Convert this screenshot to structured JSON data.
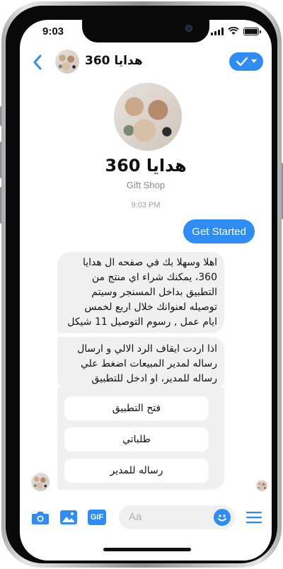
{
  "status_bar": {
    "time": "9:03"
  },
  "header": {
    "title": "هدايا 360"
  },
  "profile": {
    "name": "هدايا 360",
    "category": "Gift Shop"
  },
  "timestamp": "9:03 PM",
  "messages": {
    "sent": "Get Started",
    "bot_1_lines": [
      "اهلا وسهلا بك في صفحه ال هدايا",
      "360، يمكنك شراء اي منتج من",
      "التطبيق بداخل المسنجر وسيتم",
      "توصيله لعنوانك خلال اربع لخمس",
      "ايام عمل , رسوم التوصيل 11 شيكل"
    ],
    "bot_2_lines": [
      "اذا اردت ايقاف الرد الالي و ارسال",
      "رساله لمدير المبيعات اضغط علي",
      "رساله للمدير، او ادخل للتطبيق"
    ],
    "quick_replies": [
      "فتح التطبيق",
      "طلباتي",
      "رساله للمدير"
    ]
  },
  "composer": {
    "placeholder": "Aa",
    "gif_label": "GIF"
  },
  "colors": {
    "accent": "#2f8cf5",
    "bubble": "#f0f0f0"
  }
}
